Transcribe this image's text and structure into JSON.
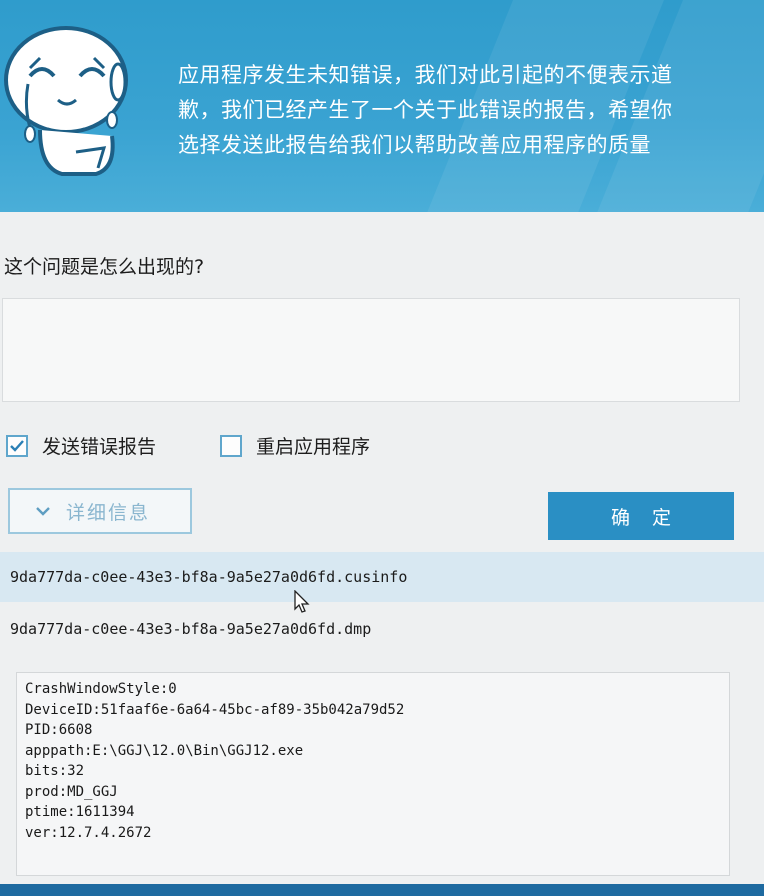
{
  "header": {
    "message_lines": [
      "应用程序发生未知错误，我们对此引起的不便表示道",
      "歉，我们已经产生了一个关于此错误的报告，希望你",
      "选择发送此报告给我们以帮助改善应用程序的质量"
    ],
    "mascot_icon": "crying-face-icon"
  },
  "question": {
    "label": "这个问题是怎么出现的?",
    "value": "",
    "placeholder": ""
  },
  "options": {
    "send_report": {
      "label": "发送错误报告",
      "checked": true
    },
    "restart_app": {
      "label": "重启应用程序",
      "checked": false
    }
  },
  "buttons": {
    "details_label": "详细信息",
    "ok_label": "确定"
  },
  "files": [
    {
      "name": "9da777da-c0ee-43e3-bf8a-9a5e27a0d6fd.cusinfo",
      "selected": true
    },
    {
      "name": "9da777da-c0ee-43e3-bf8a-9a5e27a0d6fd.dmp",
      "selected": false
    }
  ],
  "info_lines": [
    "CrashWindowStyle:0",
    "DeviceID:51faaf6e-6a64-45bc-af89-35b042a79d52",
    "PID:6608",
    "apppath:E:\\GGJ\\12.0\\Bin\\GGJ12.exe",
    "bits:32",
    "prod:MD_GGJ",
    "ptime:1611394",
    "ver:12.7.4.2672"
  ],
  "colors": {
    "header_bg": "#3aa3d2",
    "accent": "#2a8fc4",
    "selected_row": "#d8e8f2"
  }
}
